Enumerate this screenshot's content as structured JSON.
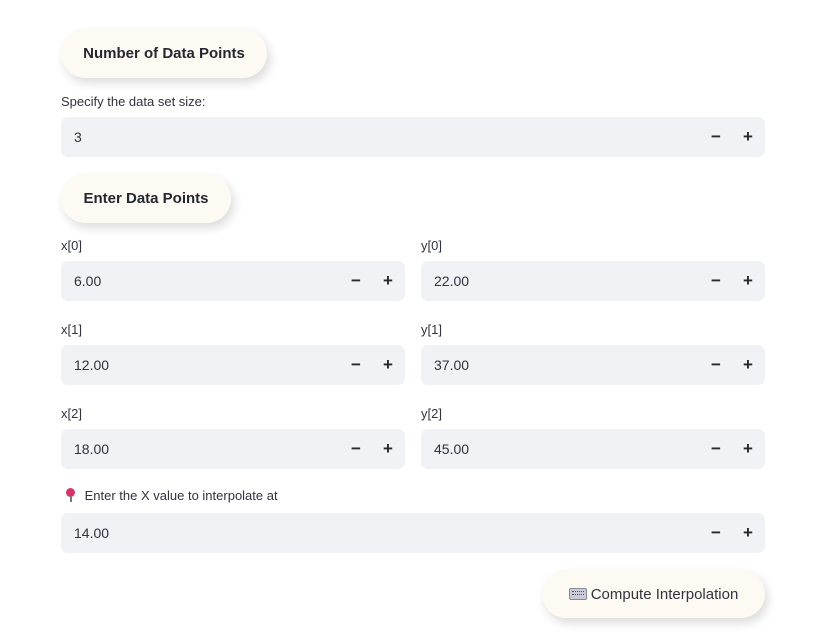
{
  "section1": {
    "title": "Number of Data Points"
  },
  "size_field": {
    "label": "Specify the data set size:",
    "value": "3"
  },
  "section2": {
    "title": "Enter Data Points"
  },
  "points": [
    {
      "x_label": "x[0]",
      "x_value": "6.00",
      "y_label": "y[0]",
      "y_value": "22.00"
    },
    {
      "x_label": "x[1]",
      "x_value": "12.00",
      "y_label": "y[1]",
      "y_value": "37.00"
    },
    {
      "x_label": "x[2]",
      "x_value": "18.00",
      "y_label": "y[2]",
      "y_value": "45.00"
    }
  ],
  "interp_field": {
    "label": "Enter the X value to interpolate at",
    "icon": "pushpin-icon",
    "value": "14.00"
  },
  "stepper": {
    "minus": "−",
    "plus": "+"
  },
  "compute_button": {
    "label": "Compute Interpolation",
    "icon": "keyboard-icon"
  }
}
